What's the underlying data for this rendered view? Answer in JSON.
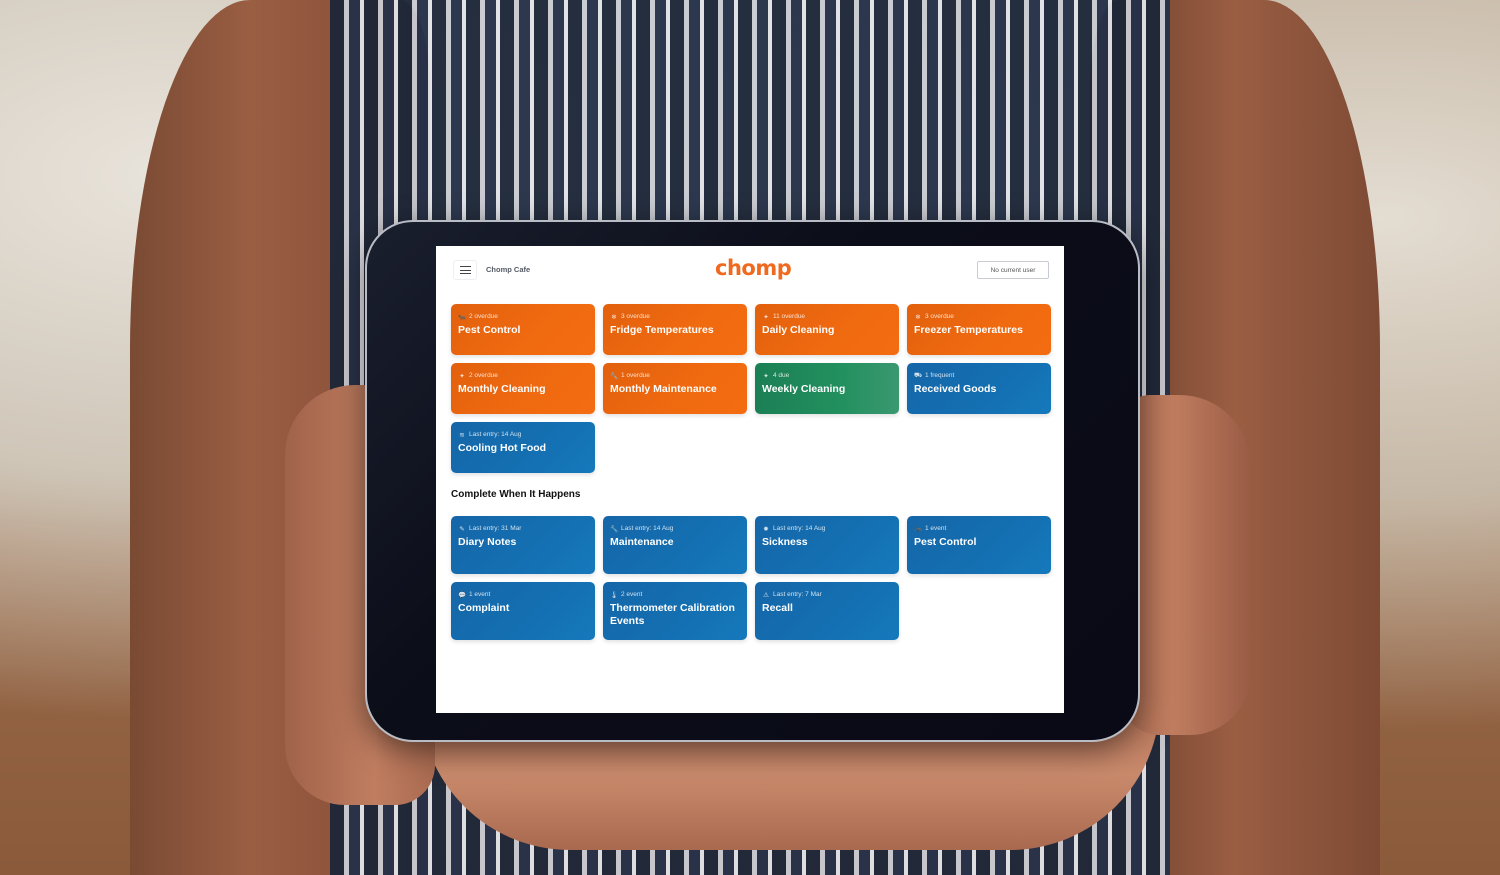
{
  "header": {
    "cafe_name": "Chomp Cafe",
    "logo": "chomp",
    "user_button": "No current user",
    "menu_icon": "hamburger-menu-icon"
  },
  "scheduled_tasks": [
    {
      "icon": "bug-icon",
      "glyph": "🐜",
      "meta": "2 overdue",
      "title": "Pest Control",
      "status": "overdue",
      "color": "#ef6a10"
    },
    {
      "icon": "snowflake-icon",
      "glyph": "❄",
      "meta": "3 overdue",
      "title": "Fridge Temperatures",
      "status": "overdue",
      "color": "#ef6a10"
    },
    {
      "icon": "sparkle-icon",
      "glyph": "✦",
      "meta": "11 overdue",
      "title": "Daily Cleaning",
      "status": "overdue",
      "color": "#ef6a10"
    },
    {
      "icon": "snowflake-icon",
      "glyph": "❄",
      "meta": "3 overdue",
      "title": "Freezer Temperatures",
      "status": "overdue",
      "color": "#ef6a10"
    },
    {
      "icon": "sparkle-icon",
      "glyph": "✦",
      "meta": "2 overdue",
      "title": "Monthly Cleaning",
      "status": "overdue",
      "color": "#ef6a10"
    },
    {
      "icon": "wrench-icon",
      "glyph": "🔧",
      "meta": "1 overdue",
      "title": "Monthly Maintenance",
      "status": "overdue",
      "color": "#ef6a10"
    },
    {
      "icon": "sparkle-icon",
      "glyph": "✦",
      "meta": "4 due",
      "title": "Weekly Cleaning",
      "status": "due",
      "color": "#1f8a5a"
    },
    {
      "icon": "truck-icon",
      "glyph": "⛟",
      "meta": "1 frequent",
      "title": "Received Goods",
      "status": "frequent",
      "color": "#1470b2"
    },
    {
      "icon": "wind-icon",
      "glyph": "≋",
      "meta": "Last entry: 14 Aug",
      "title": "Cooling Hot Food",
      "status": "ok",
      "color": "#1470b2"
    }
  ],
  "section_title": "Complete When It Happens",
  "event_tasks": [
    {
      "icon": "edit-icon",
      "glyph": "✎",
      "meta": "Last entry: 31 Mar",
      "title": "Diary Notes"
    },
    {
      "icon": "wrench-icon",
      "glyph": "🔧",
      "meta": "Last entry: 14 Aug",
      "title": "Maintenance"
    },
    {
      "icon": "virus-icon",
      "glyph": "✹",
      "meta": "Last entry: 14 Aug",
      "title": "Sickness"
    },
    {
      "icon": "bug-icon",
      "glyph": "🐜",
      "meta": "1 event",
      "title": "Pest Control"
    },
    {
      "icon": "chat-icon",
      "glyph": "💬",
      "meta": "1 event",
      "title": "Complaint"
    },
    {
      "icon": "thermometer-icon",
      "glyph": "🌡",
      "meta": "2 event",
      "title": "Thermometer Calibration Events"
    },
    {
      "icon": "warning-icon",
      "glyph": "⚠",
      "meta": "Last entry: 7 Mar",
      "title": "Recall"
    }
  ]
}
